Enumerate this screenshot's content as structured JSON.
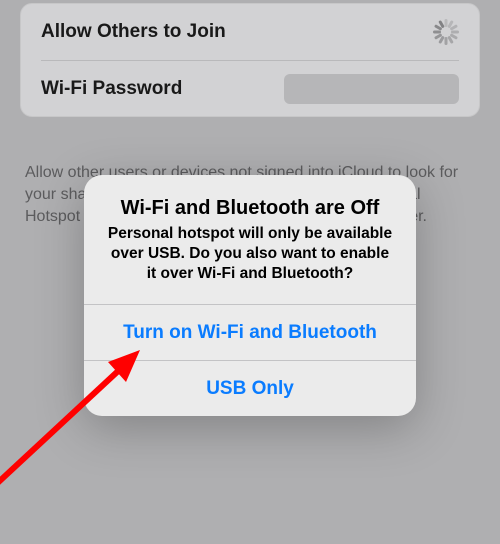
{
  "card": {
    "allow_label": "Allow Others to Join",
    "password_label": "Wi-Fi Password"
  },
  "footer_text": "Allow other users or devices not signed into iCloud to look for your shared network \"iPhone\" when you are in Personal Hotspot settings or when you turn it on in Control Center.",
  "alert": {
    "title": "Wi-Fi and Bluetooth are Off",
    "message": "Personal hotspot will only be available over USB. Do you also want to enable it over Wi-Fi and Bluetooth?",
    "primary": "Turn on Wi-Fi and Bluetooth",
    "secondary": "USB Only"
  }
}
